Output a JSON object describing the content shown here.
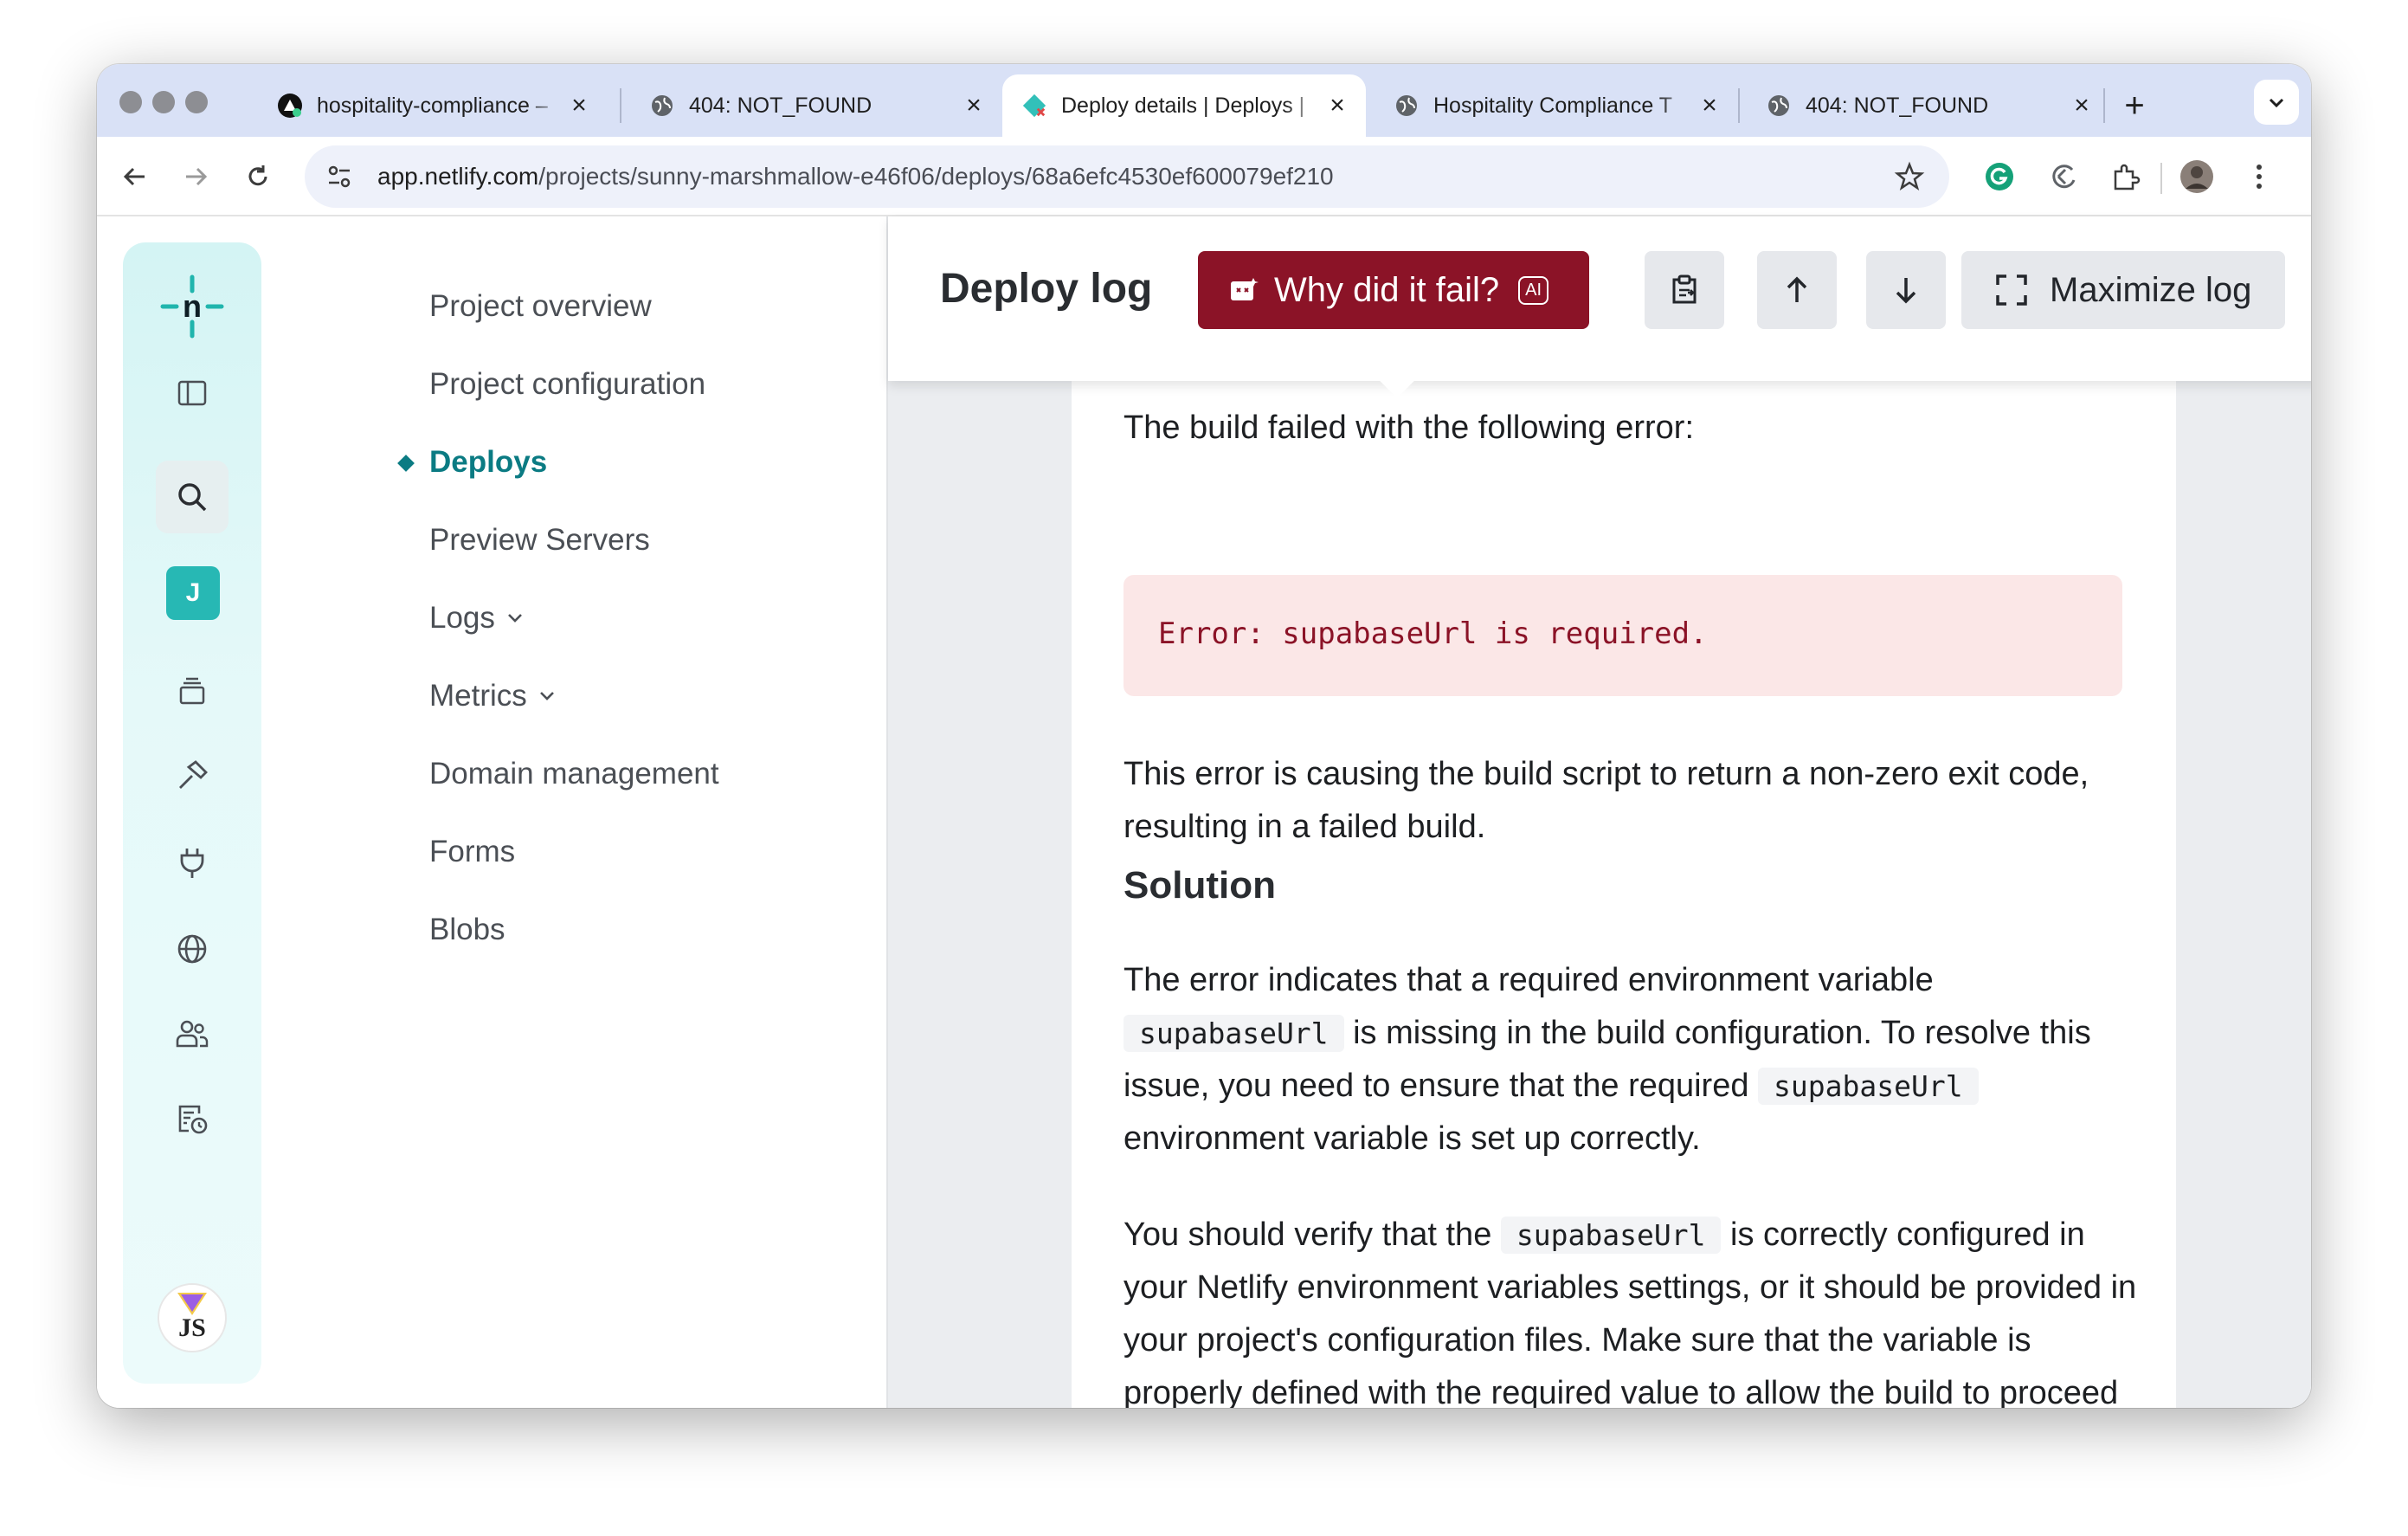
{
  "browser": {
    "tabs": [
      {
        "title": "hospitality-compliance –",
        "icon": "vercel-icon",
        "active": false
      },
      {
        "title": "404: NOT_FOUND",
        "icon": "globe-icon",
        "active": false
      },
      {
        "title": "Deploy details | Deploys |",
        "icon": "netlify-icon",
        "active": true
      },
      {
        "title": "Hospitality Compliance T",
        "icon": "globe-icon",
        "active": false
      },
      {
        "title": "404: NOT_FOUND",
        "icon": "globe-icon",
        "active": false
      }
    ],
    "url_host": "app.netlify.com",
    "url_path": "/projects/sunny-marshmallow-e46f06/deploys/68a6efc4530ef600079ef210"
  },
  "rail": {
    "workspace_initial": "J"
  },
  "sidebar": {
    "items": [
      {
        "label": "Project overview"
      },
      {
        "label": "Project configuration"
      },
      {
        "label": "Deploys"
      },
      {
        "label": "Preview Servers"
      },
      {
        "label": "Logs"
      },
      {
        "label": "Metrics"
      },
      {
        "label": "Domain management"
      },
      {
        "label": "Forms"
      },
      {
        "label": "Blobs"
      }
    ]
  },
  "log": {
    "title": "Deploy log",
    "why_button": "Why did it fail?",
    "ai_badge": "AI",
    "maximize_button": "Maximize log"
  },
  "analysis": {
    "intro": "The build failed with the following error:",
    "error_code": "Error: supabaseUrl is required.",
    "explanation": "This error is causing the build script to return a non-zero exit code, resulting in a failed build.",
    "solution_heading": "Solution",
    "sol1_a": "The error indicates that a required environment variable",
    "sol1_code": "supabaseUrl",
    "sol1_b": "is missing in the build configuration. To resolve this issue, you need to ensure that the required",
    "sol1_code2": "supabaseUrl",
    "sol1_c": "environment variable is set up correctly.",
    "sol2_a": "You should verify that the",
    "sol2_code": "supabaseUrl",
    "sol2_b": "is correctly configured in your Netlify environment variables settings, or it should be provided in your project's configuration files. Make sure that the variable is properly defined with the required value to allow the build to proceed successfully."
  },
  "colors": {
    "accent": "#0b7b83",
    "fail_button": "#8b1327",
    "error_bg": "#fbe7e7"
  }
}
